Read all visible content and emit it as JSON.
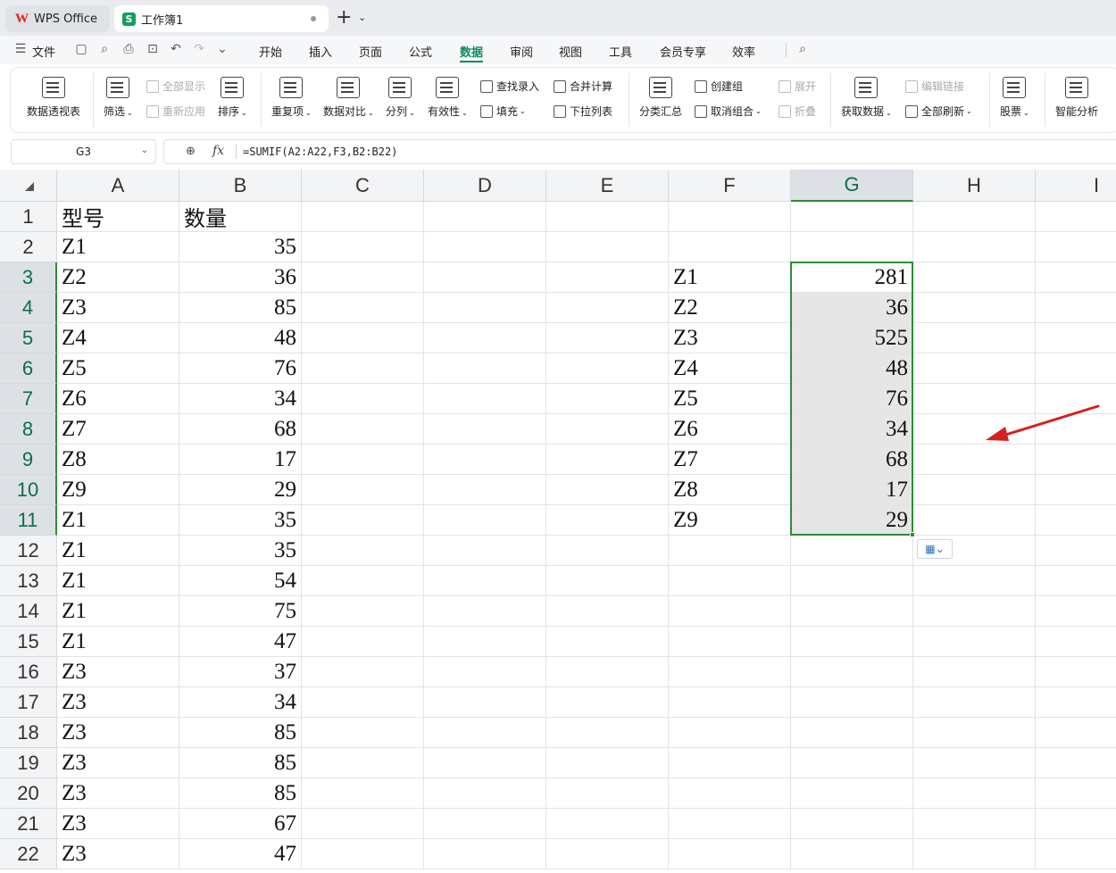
{
  "tabs": [
    {
      "label": "WPS Office",
      "logo": "W"
    },
    {
      "label": "工作簿1",
      "logo": "S"
    }
  ],
  "menu": {
    "file": "文件",
    "items": [
      "开始",
      "插入",
      "页面",
      "公式",
      "数据",
      "审阅",
      "视图",
      "工具",
      "会员专享",
      "效率"
    ],
    "active": "数据"
  },
  "ribbon": {
    "pivot": "数据透视表",
    "filter": "筛选",
    "show_all": "全部显示",
    "reapply": "重新应用",
    "sort": "排序",
    "duplicates": "重复项",
    "compare": "数据对比",
    "split": "分列",
    "validity": "有效性",
    "lookup_entry": "查找录入",
    "fill": "填充",
    "consolidate": "合并计算",
    "dropdown_list": "下拉列表",
    "subtotal": "分类汇总",
    "create_group": "创建组",
    "ungroup": "取消组合",
    "expand": "展开",
    "collapse": "折叠",
    "get_data": "获取数据",
    "edit_links": "编辑链接",
    "refresh_all": "全部刷新",
    "stocks": "股票",
    "smart_analysis": "智能分析"
  },
  "formula_bar": {
    "cell_ref": "G3",
    "formula": "=SUMIF(A2:A22,F3,B2:B22)"
  },
  "columns": [
    "A",
    "B",
    "C",
    "D",
    "E",
    "F",
    "G",
    "H",
    "I"
  ],
  "selected_column": "G",
  "rows": [
    "1",
    "2",
    "3",
    "4",
    "5",
    "6",
    "7",
    "8",
    "9",
    "10",
    "11",
    "12",
    "13",
    "14",
    "15",
    "16",
    "17",
    "18",
    "19",
    "20",
    "21",
    "22"
  ],
  "selected_rows": [
    "3",
    "4",
    "5",
    "6",
    "7",
    "8",
    "9",
    "10",
    "11"
  ],
  "col_a": [
    "型号",
    "Z1",
    "Z2",
    "Z3",
    "Z4",
    "Z5",
    "Z6",
    "Z7",
    "Z8",
    "Z9",
    "Z1",
    "Z1",
    "Z1",
    "Z1",
    "Z1",
    "Z3",
    "Z3",
    "Z3",
    "Z3",
    "Z3",
    "Z3",
    "Z3"
  ],
  "col_b": [
    "数量",
    "35",
    "36",
    "85",
    "48",
    "76",
    "34",
    "68",
    "17",
    "29",
    "35",
    "35",
    "54",
    "75",
    "47",
    "37",
    "34",
    "85",
    "85",
    "85",
    "67",
    "47"
  ],
  "col_f": [
    "",
    "",
    "Z1",
    "Z2",
    "Z3",
    "Z4",
    "Z5",
    "Z6",
    "Z7",
    "Z8",
    "Z9",
    "",
    "",
    "",
    "",
    "",
    "",
    "",
    "",
    "",
    "",
    ""
  ],
  "col_g": [
    "",
    "",
    "281",
    "36",
    "525",
    "48",
    "76",
    "34",
    "68",
    "17",
    "29",
    "",
    "",
    "",
    "",
    "",
    "",
    "",
    "",
    "",
    "",
    ""
  ],
  "annotation_arrow_color": "#d42020",
  "accent_color": "#0d8a5e",
  "selection_color": "#2e8b3a"
}
